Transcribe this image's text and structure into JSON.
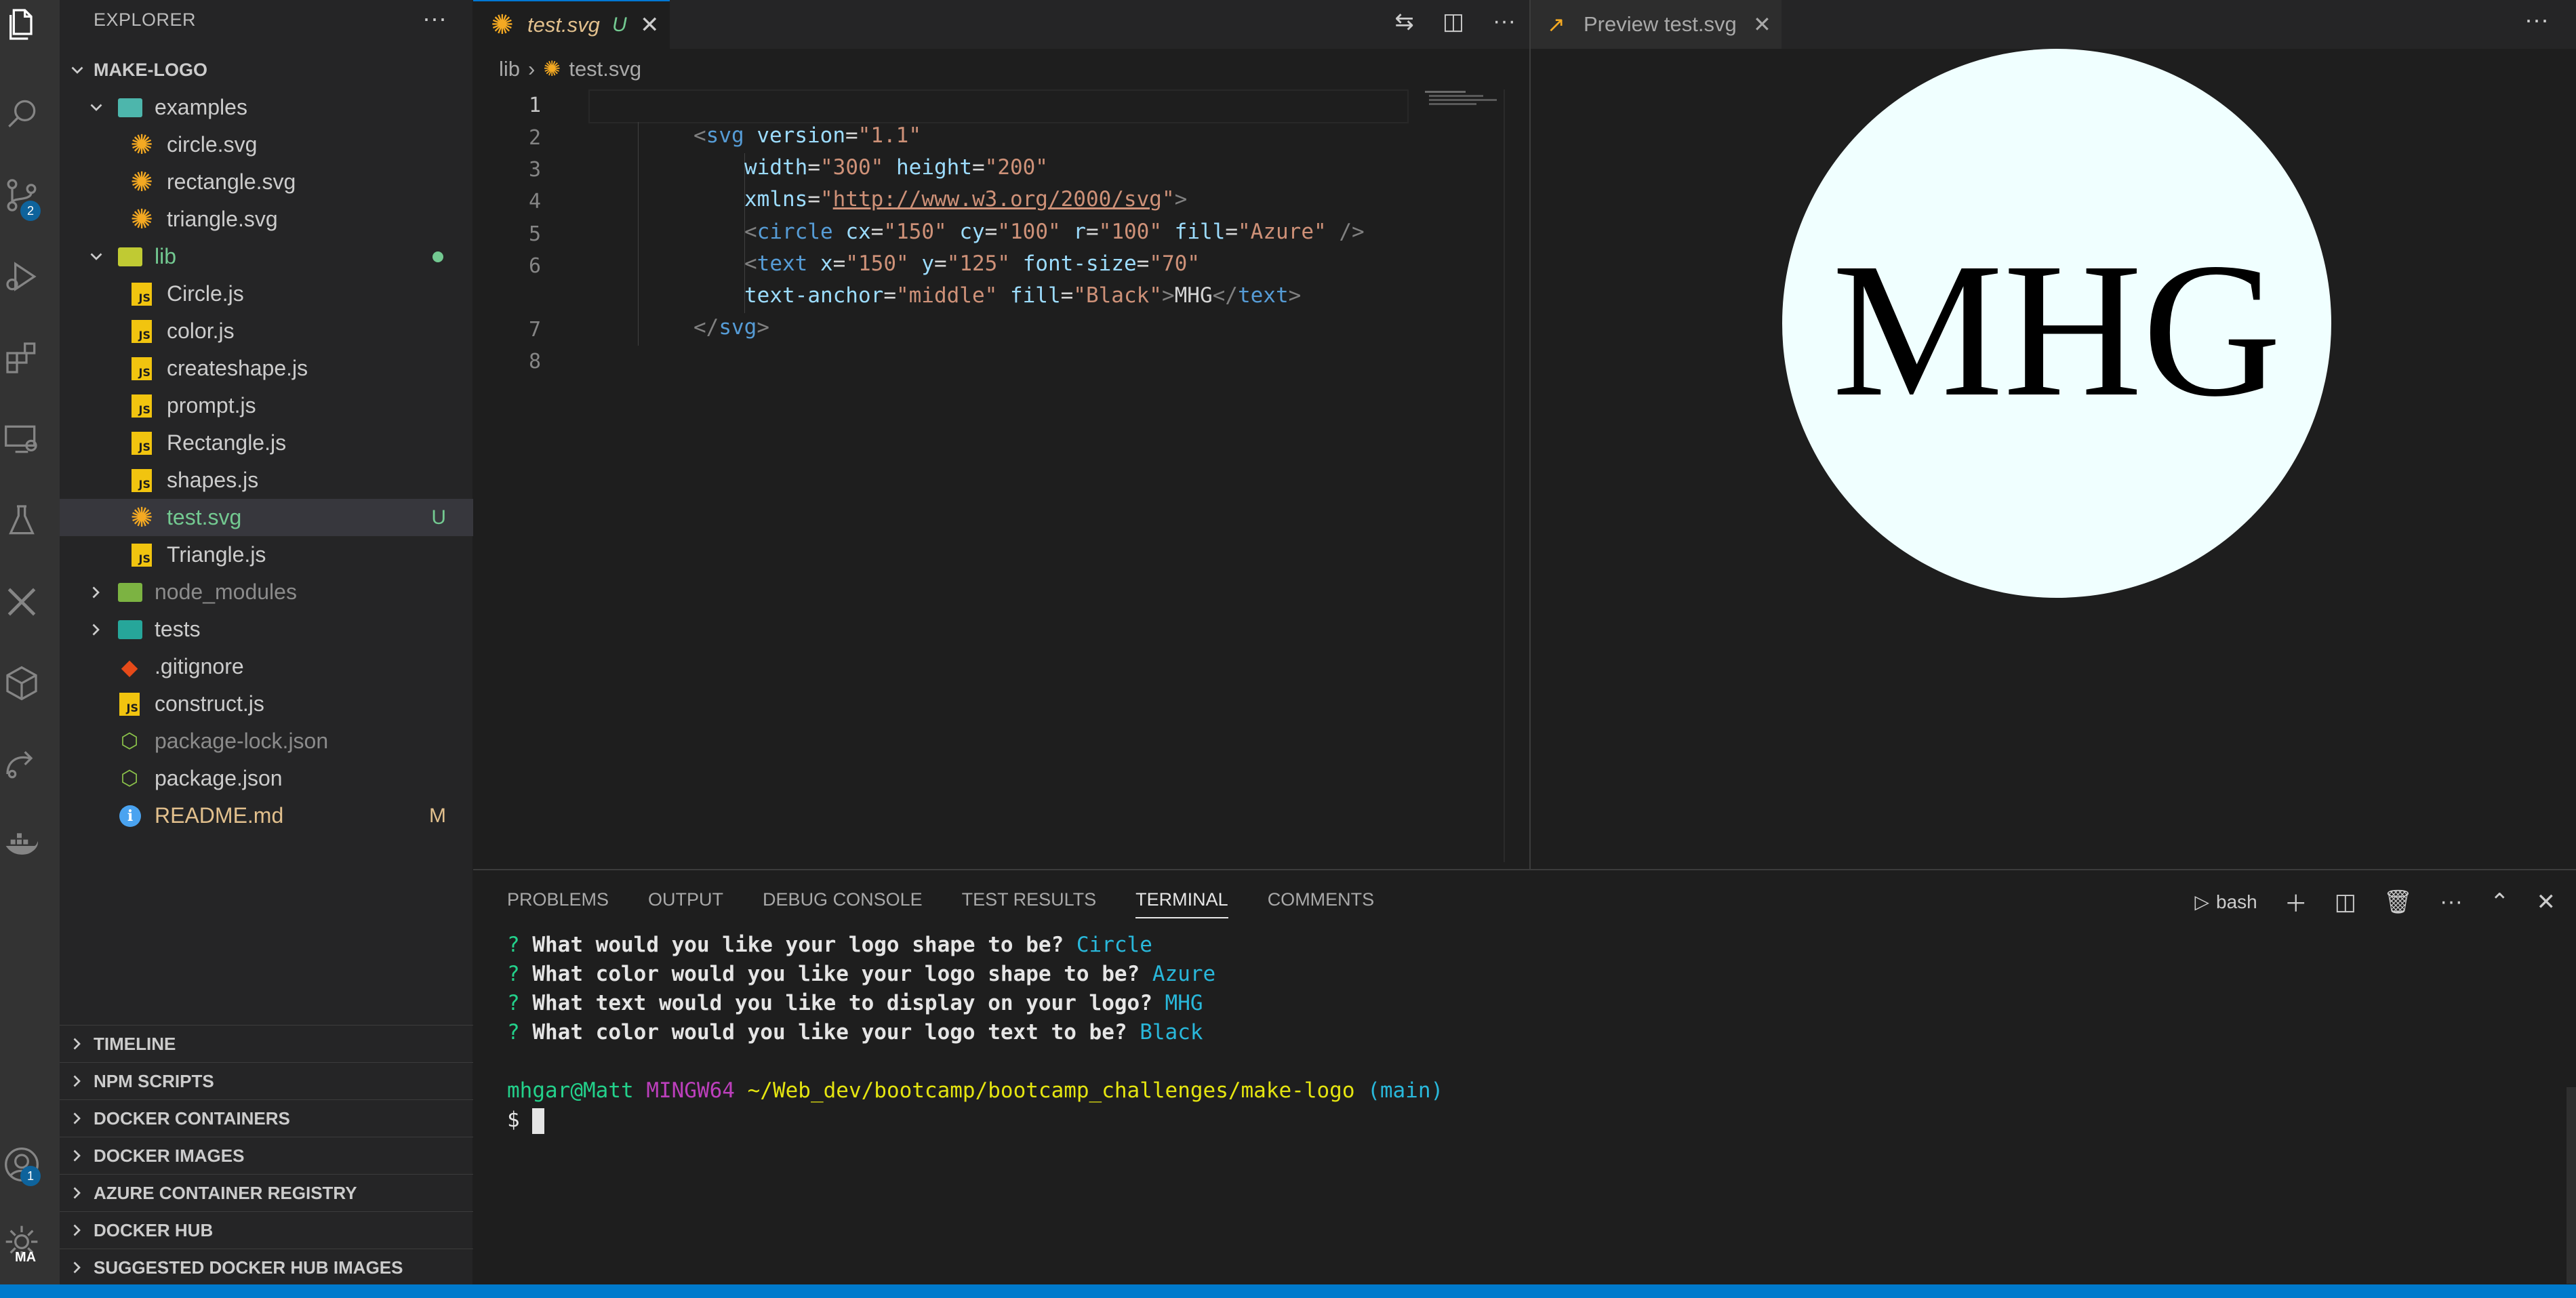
{
  "activity_bar": {
    "scm_badge": "2",
    "account_badge": "1",
    "manage_label": "MA"
  },
  "explorer": {
    "header": "EXPLORER",
    "project": "MAKE-LOGO",
    "items": [
      {
        "label": "examples",
        "type": "folder-open",
        "depth": 1
      },
      {
        "label": "circle.svg",
        "type": "svg",
        "depth": 2
      },
      {
        "label": "rectangle.svg",
        "type": "svg",
        "depth": 2
      },
      {
        "label": "triangle.svg",
        "type": "svg",
        "depth": 2
      },
      {
        "label": "lib",
        "type": "folder-open",
        "depth": 1
      },
      {
        "label": "Circle.js",
        "type": "js",
        "depth": 2
      },
      {
        "label": "color.js",
        "type": "js",
        "depth": 2
      },
      {
        "label": "createshape.js",
        "type": "js",
        "depth": 2
      },
      {
        "label": "prompt.js",
        "type": "js",
        "depth": 2
      },
      {
        "label": "Rectangle.js",
        "type": "js",
        "depth": 2
      },
      {
        "label": "shapes.js",
        "type": "js",
        "depth": 2
      },
      {
        "label": "test.svg",
        "type": "svg",
        "depth": 2
      },
      {
        "label": "Triangle.js",
        "type": "js",
        "depth": 2
      },
      {
        "label": "node_modules",
        "type": "folder",
        "depth": 1
      },
      {
        "label": "tests",
        "type": "folder",
        "depth": 1
      },
      {
        "label": ".gitignore",
        "type": "git",
        "depth": 1
      },
      {
        "label": "construct.js",
        "type": "js",
        "depth": 1
      },
      {
        "label": "package-lock.json",
        "type": "node",
        "depth": 1
      },
      {
        "label": "package.json",
        "type": "node",
        "depth": 1
      },
      {
        "label": "README.md",
        "type": "info",
        "depth": 1
      }
    ],
    "test_svg_status": "U",
    "readme_status": "M",
    "sections": [
      "TIMELINE",
      "NPM SCRIPTS",
      "DOCKER CONTAINERS",
      "DOCKER IMAGES",
      "AZURE CONTAINER REGISTRY",
      "DOCKER HUB",
      "SUGGESTED DOCKER HUB IMAGES"
    ]
  },
  "editor": {
    "tab_title": "test.svg",
    "tab_status": "U",
    "breadcrumb": [
      "lib",
      "test.svg"
    ],
    "line_numbers": [
      "1",
      "2",
      "3",
      "4",
      "5",
      "6",
      "7",
      "8"
    ]
  },
  "preview": {
    "tab_title": "Preview test.svg",
    "logo_text": "MHG",
    "circle_fill": "#f0ffff",
    "text_fill": "#000000"
  },
  "panel": {
    "tabs": [
      "PROBLEMS",
      "OUTPUT",
      "DEBUG CONSOLE",
      "TEST RESULTS",
      "TERMINAL",
      "COMMENTS"
    ],
    "active_tab": "TERMINAL",
    "shell": "bash",
    "terminal": {
      "questions": [
        {
          "q": "What would you like your logo shape to be?",
          "a": "Circle"
        },
        {
          "q": "What color would you like your logo shape to be?",
          "a": "Azure"
        },
        {
          "q": "What text would you like to display on your logo?",
          "a": "MHG"
        },
        {
          "q": "What color would you like your logo text to be?",
          "a": "Black"
        }
      ],
      "user": "mhgar@Matt",
      "host": "MINGW64",
      "path": "~/Web_dev/bootcamp/bootcamp_challenges/make-logo",
      "branch": "(main)",
      "prompt_symbol": "$"
    }
  }
}
